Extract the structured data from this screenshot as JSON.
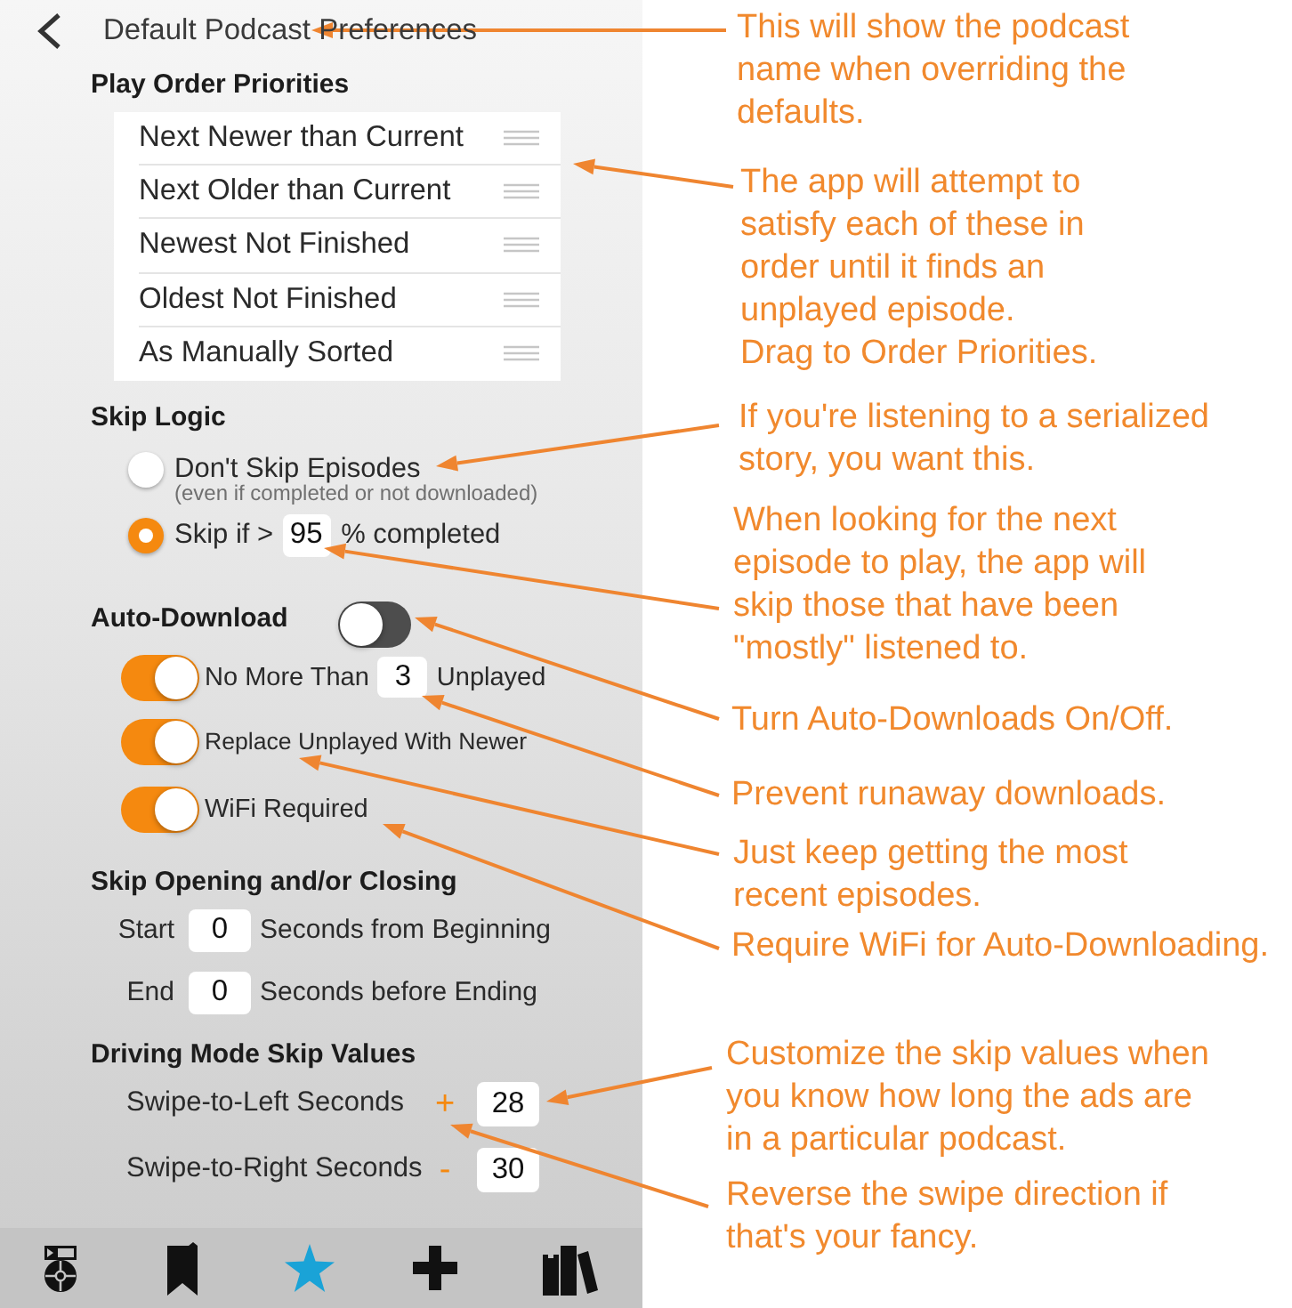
{
  "header": {
    "title": "Default Podcast Preferences"
  },
  "play_order": {
    "heading": "Play Order Priorities",
    "items": [
      {
        "label": "Next Newer than Current"
      },
      {
        "label": "Next Older than Current"
      },
      {
        "label": "Newest Not Finished"
      },
      {
        "label": "Oldest Not Finished"
      },
      {
        "label": "As Manually Sorted"
      }
    ]
  },
  "skip_logic": {
    "heading": "Skip Logic",
    "options": [
      {
        "kind": "plain",
        "label": "Don't Skip Episodes",
        "note": "(even if completed or not downloaded)",
        "selected": false
      },
      {
        "kind": "threshold",
        "label": "Skip if >",
        "value": "95",
        "suffix": "% completed",
        "selected": true
      }
    ]
  },
  "auto_download": {
    "heading": "Auto-Download",
    "on": false,
    "options": [
      {
        "kind": "limit",
        "label": "No More Than",
        "value": "3",
        "suffix": "Unplayed",
        "on": true
      },
      {
        "kind": "plain",
        "label": "Replace Unplayed With Newer",
        "on": true
      },
      {
        "kind": "plain",
        "label": "WiFi Required",
        "on": true
      }
    ]
  },
  "skip_opening_closing": {
    "heading": "Skip Opening and/or Closing",
    "rows": [
      {
        "label": "Start",
        "value": "0",
        "suffix": "Seconds from Beginning"
      },
      {
        "label": "End",
        "value": "0",
        "suffix": "Seconds before Ending"
      }
    ]
  },
  "driving_mode": {
    "heading": "Driving Mode Skip Values",
    "rows": [
      {
        "label": "Swipe-to-Left Seconds",
        "sign": "+",
        "value": "28"
      },
      {
        "label": "Swipe-to-Right Seconds",
        "sign": "-",
        "value": "30"
      }
    ]
  },
  "tab_bar": [
    {
      "selected": false
    },
    {
      "selected": false
    },
    {
      "selected": true
    },
    {
      "selected": false
    },
    {
      "selected": false
    }
  ],
  "annotations": [
    {
      "text": "This will show the podcast\nname when overriding the\ndefaults."
    },
    {
      "text": "The app will attempt to\nsatisfy each of these in\norder until it finds an\nunplayed episode.\nDrag to Order Priorities."
    },
    {
      "text": "If you're listening to a serialized\nstory, you want this."
    },
    {
      "text": "When looking for the next\nepisode to play, the app will\nskip those that have been\n\"mostly\" listened to."
    },
    {
      "text": "Turn Auto-Downloads On/Off."
    },
    {
      "text": "Prevent runaway downloads."
    },
    {
      "text": "Just keep getting the most\nrecent episodes."
    },
    {
      "text": "Require WiFi for Auto-Downloading."
    },
    {
      "text": "Customize the skip values when\nyou know how long the ads are\nin a particular podcast."
    },
    {
      "text": "Reverse the swipe direction if\nthat's your fancy."
    }
  ]
}
